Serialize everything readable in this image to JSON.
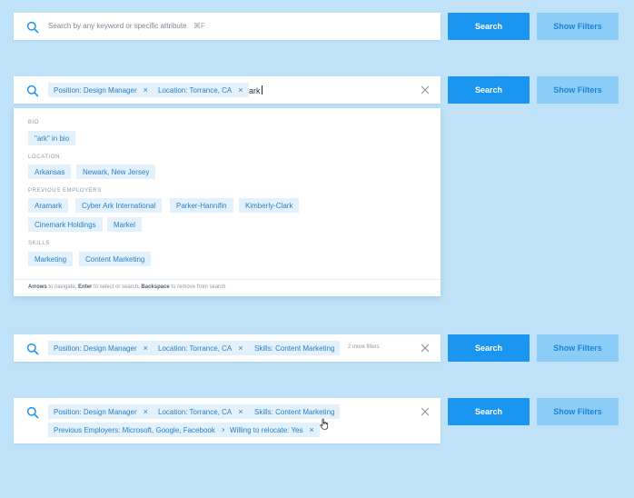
{
  "colors": {
    "primary": "#1a96f0",
    "secondary_bg": "#8ccdf7",
    "chip_bg": "#e3f1fc",
    "chip_text": "#2a7fc1",
    "background": "#bfe2f8"
  },
  "buttons": {
    "search": "Search",
    "show_filters": "Show Filters"
  },
  "bar1": {
    "placeholder": "Search by any keyword or specific attribute",
    "shortcut": "⌘F"
  },
  "chips": {
    "position": "Position: Design Manager",
    "location": "Location: Torrance, CA",
    "skills": "Skills: Content Marketing",
    "employers": "Previous Employers: Microsoft, Google, Facebook",
    "relocate": "Willing to relocate: Yes",
    "remove": "×"
  },
  "bar2": {
    "query": "ark"
  },
  "bar3": {
    "more": "2 more filters"
  },
  "dropdown": {
    "bio": {
      "label": "BIO",
      "options": [
        "\"ark\" in bio"
      ]
    },
    "location": {
      "label": "LOCATION",
      "options": [
        "Arkansas",
        "Newark, New Jersey"
      ]
    },
    "employers": {
      "label": "PREVIOUS EMPLOYERS",
      "options": [
        "Aramark",
        "Cyber Ark International",
        "Parker-Hannifin",
        "Kimberly-Clark",
        "Cinemark Holdings",
        "Markel"
      ]
    },
    "skills": {
      "label": "SKILLS",
      "options": [
        "Marketing",
        "Content Marketing"
      ]
    },
    "footer": {
      "k1": "Arrows",
      "t1": " to navigate, ",
      "k2": "Enter",
      "t2": " to select or search, ",
      "k3": "Backspace",
      "t3": " to remove from search"
    }
  }
}
